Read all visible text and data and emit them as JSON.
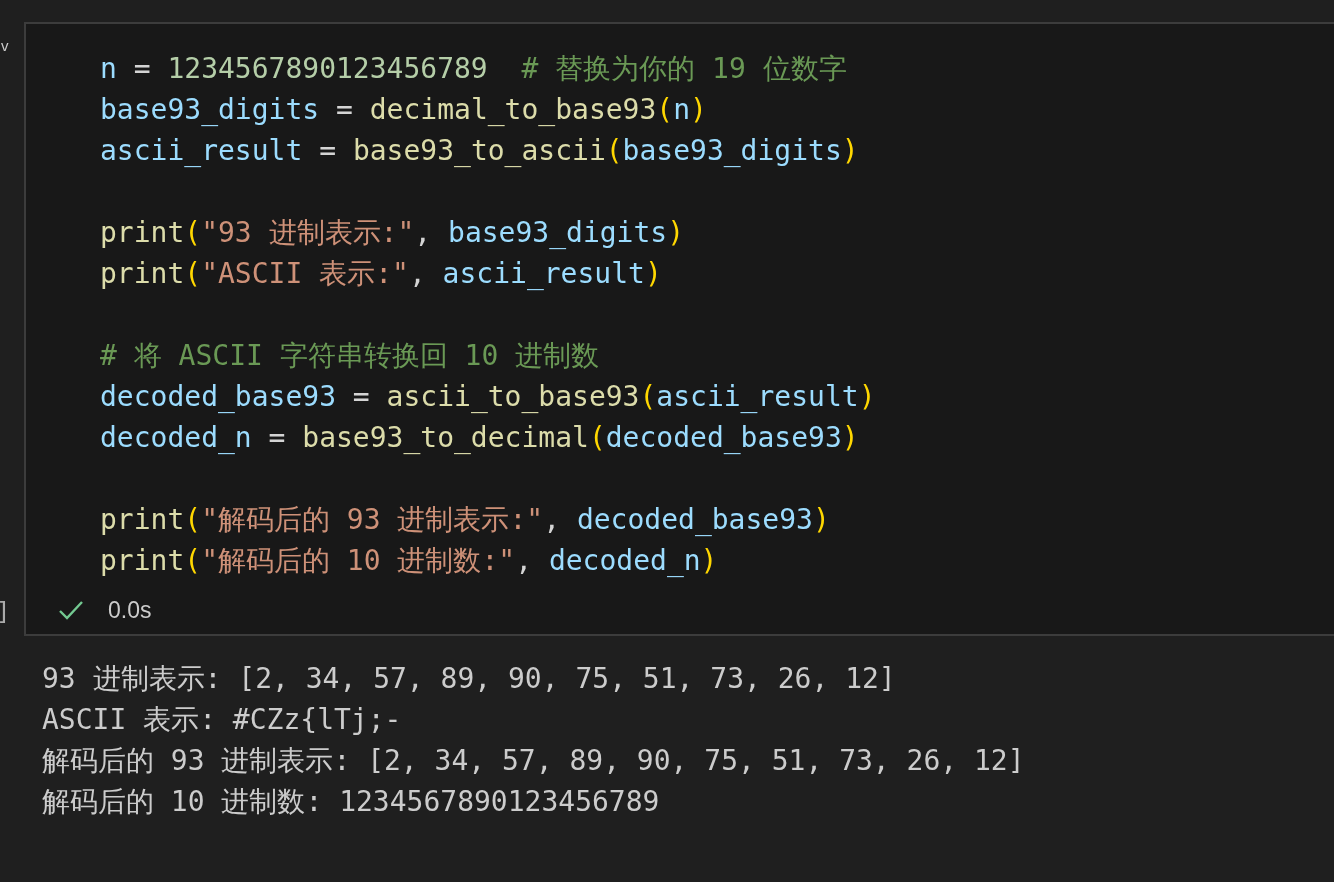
{
  "cell": {
    "collapse_icon": "v",
    "execution_count": "]",
    "code_lines": [
      {
        "kind": "code",
        "tokens": [
          {
            "text": "n",
            "kind": "var"
          },
          {
            "text": " = ",
            "kind": "op"
          },
          {
            "text": "1234567890123456789",
            "kind": "num"
          },
          {
            "text": "  # 替换为你的 19 位数字",
            "kind": "comment"
          }
        ]
      },
      {
        "kind": "code",
        "tokens": [
          {
            "text": "base93_digits",
            "kind": "var"
          },
          {
            "text": " = ",
            "kind": "op"
          },
          {
            "text": "decimal_to_base93",
            "kind": "func"
          },
          {
            "text": "(",
            "kind": "paren"
          },
          {
            "text": "n",
            "kind": "var"
          },
          {
            "text": ")",
            "kind": "paren"
          }
        ]
      },
      {
        "kind": "code",
        "tokens": [
          {
            "text": "ascii_result",
            "kind": "var"
          },
          {
            "text": " = ",
            "kind": "op"
          },
          {
            "text": "base93_to_ascii",
            "kind": "func"
          },
          {
            "text": "(",
            "kind": "paren"
          },
          {
            "text": "base93_digits",
            "kind": "var"
          },
          {
            "text": ")",
            "kind": "paren"
          }
        ]
      },
      {
        "kind": "blank"
      },
      {
        "kind": "code",
        "tokens": [
          {
            "text": "print",
            "kind": "func"
          },
          {
            "text": "(",
            "kind": "paren"
          },
          {
            "text": "\"93 进制表示:\"",
            "kind": "string"
          },
          {
            "text": ", ",
            "kind": "op"
          },
          {
            "text": "base93_digits",
            "kind": "var"
          },
          {
            "text": ")",
            "kind": "paren"
          }
        ]
      },
      {
        "kind": "code",
        "tokens": [
          {
            "text": "print",
            "kind": "func"
          },
          {
            "text": "(",
            "kind": "paren"
          },
          {
            "text": "\"ASCII 表示:\"",
            "kind": "string"
          },
          {
            "text": ", ",
            "kind": "op"
          },
          {
            "text": "ascii_result",
            "kind": "var"
          },
          {
            "text": ")",
            "kind": "paren"
          }
        ]
      },
      {
        "kind": "blank"
      },
      {
        "kind": "code",
        "tokens": [
          {
            "text": "# 将 ASCII 字符串转换回 10 进制数",
            "kind": "comment"
          }
        ]
      },
      {
        "kind": "code",
        "tokens": [
          {
            "text": "decoded_base93",
            "kind": "var"
          },
          {
            "text": " = ",
            "kind": "op"
          },
          {
            "text": "ascii_to_base93",
            "kind": "func"
          },
          {
            "text": "(",
            "kind": "paren"
          },
          {
            "text": "ascii_result",
            "kind": "var"
          },
          {
            "text": ")",
            "kind": "paren"
          }
        ]
      },
      {
        "kind": "code",
        "tokens": [
          {
            "text": "decoded_n",
            "kind": "var"
          },
          {
            "text": " = ",
            "kind": "op"
          },
          {
            "text": "base93_to_decimal",
            "kind": "func"
          },
          {
            "text": "(",
            "kind": "paren"
          },
          {
            "text": "decoded_base93",
            "kind": "var"
          },
          {
            "text": ")",
            "kind": "paren"
          }
        ]
      },
      {
        "kind": "blank"
      },
      {
        "kind": "code",
        "tokens": [
          {
            "text": "print",
            "kind": "func"
          },
          {
            "text": "(",
            "kind": "paren"
          },
          {
            "text": "\"解码后的 93 进制表示:\"",
            "kind": "string"
          },
          {
            "text": ", ",
            "kind": "op"
          },
          {
            "text": "decoded_base93",
            "kind": "var"
          },
          {
            "text": ")",
            "kind": "paren"
          }
        ]
      },
      {
        "kind": "code",
        "tokens": [
          {
            "text": "print",
            "kind": "func"
          },
          {
            "text": "(",
            "kind": "paren"
          },
          {
            "text": "\"解码后的 10 进制数:\"",
            "kind": "string"
          },
          {
            "text": ", ",
            "kind": "op"
          },
          {
            "text": "decoded_n",
            "kind": "var"
          },
          {
            "text": ")",
            "kind": "paren"
          }
        ]
      }
    ],
    "status": {
      "success": true,
      "duration": "0.0s"
    }
  },
  "output_lines": [
    "93 进制表示: [2, 34, 57, 89, 90, 75, 51, 73, 26, 12]",
    "ASCII 表示: #CZz{lTj;-",
    "解码后的 93 进制表示: [2, 34, 57, 89, 90, 75, 51, 73, 26, 12]",
    "解码后的 10 进制数: 1234567890123456789"
  ]
}
